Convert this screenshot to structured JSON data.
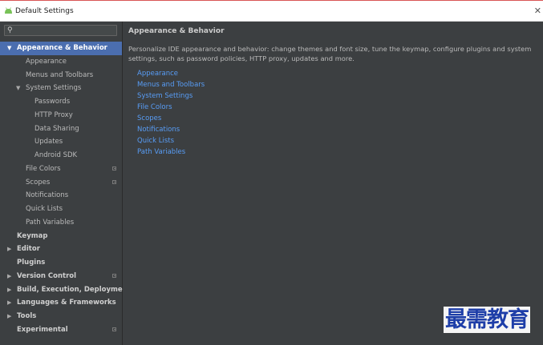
{
  "window": {
    "title": "Default Settings"
  },
  "search": {
    "placeholder": ""
  },
  "sidebar": {
    "items": [
      {
        "label": "Appearance & Behavior",
        "level": 0,
        "arrow": "▼",
        "bold": true,
        "selected": true,
        "project_icon": false
      },
      {
        "label": "Appearance",
        "level": 1,
        "arrow": "",
        "bold": false,
        "selected": false,
        "project_icon": false
      },
      {
        "label": "Menus and Toolbars",
        "level": 1,
        "arrow": "",
        "bold": false,
        "selected": false,
        "project_icon": false
      },
      {
        "label": "System Settings",
        "level": 1,
        "arrow": "▼",
        "bold": false,
        "selected": false,
        "project_icon": false
      },
      {
        "label": "Passwords",
        "level": 2,
        "arrow": "",
        "bold": false,
        "selected": false,
        "project_icon": false
      },
      {
        "label": "HTTP Proxy",
        "level": 2,
        "arrow": "",
        "bold": false,
        "selected": false,
        "project_icon": false
      },
      {
        "label": "Data Sharing",
        "level": 2,
        "arrow": "",
        "bold": false,
        "selected": false,
        "project_icon": false
      },
      {
        "label": "Updates",
        "level": 2,
        "arrow": "",
        "bold": false,
        "selected": false,
        "project_icon": false
      },
      {
        "label": "Android SDK",
        "level": 2,
        "arrow": "",
        "bold": false,
        "selected": false,
        "project_icon": false
      },
      {
        "label": "File Colors",
        "level": 1,
        "arrow": "",
        "bold": false,
        "selected": false,
        "project_icon": true
      },
      {
        "label": "Scopes",
        "level": 1,
        "arrow": "",
        "bold": false,
        "selected": false,
        "project_icon": true
      },
      {
        "label": "Notifications",
        "level": 1,
        "arrow": "",
        "bold": false,
        "selected": false,
        "project_icon": false
      },
      {
        "label": "Quick Lists",
        "level": 1,
        "arrow": "",
        "bold": false,
        "selected": false,
        "project_icon": false
      },
      {
        "label": "Path Variables",
        "level": 1,
        "arrow": "",
        "bold": false,
        "selected": false,
        "project_icon": false
      },
      {
        "label": "Keymap",
        "level": 0,
        "arrow": "",
        "bold": true,
        "selected": false,
        "project_icon": false
      },
      {
        "label": "Editor",
        "level": 0,
        "arrow": "▶",
        "bold": true,
        "selected": false,
        "project_icon": false
      },
      {
        "label": "Plugins",
        "level": 0,
        "arrow": "",
        "bold": true,
        "selected": false,
        "project_icon": false
      },
      {
        "label": "Version Control",
        "level": 0,
        "arrow": "▶",
        "bold": true,
        "selected": false,
        "project_icon": true
      },
      {
        "label": "Build, Execution, Deployment",
        "level": 0,
        "arrow": "▶",
        "bold": true,
        "selected": false,
        "project_icon": false
      },
      {
        "label": "Languages & Frameworks",
        "level": 0,
        "arrow": "▶",
        "bold": true,
        "selected": false,
        "project_icon": false
      },
      {
        "label": "Tools",
        "level": 0,
        "arrow": "▶",
        "bold": true,
        "selected": false,
        "project_icon": false
      },
      {
        "label": "Experimental",
        "level": 0,
        "arrow": "",
        "bold": true,
        "selected": false,
        "project_icon": true
      }
    ]
  },
  "main": {
    "heading": "Appearance & Behavior",
    "description": "Personalize IDE appearance and behavior: change themes and font size, tune the keymap, configure plugins and system settings, such as password policies, HTTP proxy, updates and more.",
    "links": [
      "Appearance",
      "Menus and Toolbars",
      "System Settings",
      "File Colors",
      "Scopes",
      "Notifications",
      "Quick Lists",
      "Path Variables"
    ]
  },
  "watermark": "最需教育",
  "colors": {
    "selection": "#4b6eaf",
    "link": "#589df6",
    "background": "#3c3f41",
    "android_green": "#78c257"
  }
}
